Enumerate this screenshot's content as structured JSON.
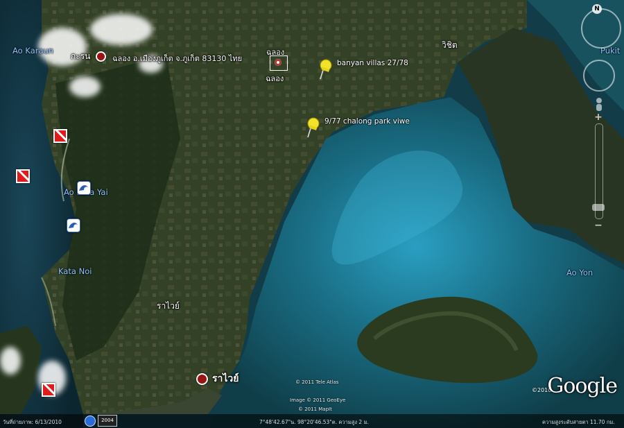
{
  "map": {
    "water_labels": {
      "ao_karon": "Ao Karaun",
      "ao_kata_yai": "Ao Kata Yai",
      "kata_noi": "Kata Noi",
      "ao_yon": "Ao Yon",
      "pukit": "Pukit"
    },
    "place_labels": {
      "karon": "กะรน",
      "chalong_address": "ฉลอง อ.เมืองภูเก็ต จ.ภูเก็ต 83130 ไทย",
      "chalong_top": "ฉลอง",
      "chalong_bottom": "ฉลอง",
      "wichit": "วิชิต",
      "rawai_upper": "ราไวย์",
      "rawai_lower": "ราไวย์"
    },
    "pins": {
      "banyan_villas": "banyan villas 27/78",
      "chalong_park": "9/77 chalong park viwe"
    },
    "attribution": {
      "tele_atlas": "© 2011 Tele Atlas",
      "geoeye": "Image © 2011 GeoEye",
      "mapit": "© 2011 MapIt",
      "year": "©2010",
      "google": "Google"
    }
  },
  "status": {
    "imagery_date": "วันที่ถ่ายภาพ: 6/13/2010",
    "history_year": "2004",
    "coordinates": "7°48'42.67\"น.   98°20'46.53\"ต.   ความสูง   2 ม.",
    "eye_altitude": "ความสูงระดับสายตา   11.70 กม."
  },
  "colors": {
    "sea_deep": "#0e3a44",
    "sea_shallow": "#1d8aa8",
    "land": "#2c3a22",
    "accent_pin": "#f2e32a",
    "dive_flag": "#e11b1b"
  }
}
